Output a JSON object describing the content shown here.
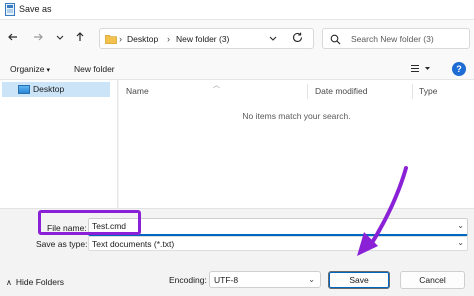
{
  "window": {
    "title": "Save as"
  },
  "address": {
    "crumbs": [
      "Desktop",
      "New folder (3)"
    ]
  },
  "search": {
    "placeholder": "Search New folder (3)"
  },
  "toolbar": {
    "organize": "Organize",
    "new_folder": "New folder"
  },
  "nav": {
    "items": [
      {
        "label": "Desktop",
        "selected": true
      }
    ]
  },
  "files": {
    "columns": [
      "Name",
      "Date modified",
      "Type"
    ],
    "empty_message": "No items match your search."
  },
  "form": {
    "file_name_label": "File name:",
    "file_name_value": "Test.cmd",
    "save_type_label": "Save as type:",
    "save_type_value": "Text documents (*.txt)",
    "encoding_label": "Encoding:",
    "encoding_value": "UTF-8"
  },
  "footer": {
    "hide_folders": "Hide Folders",
    "save": "Save",
    "cancel": "Cancel"
  },
  "colors": {
    "accent": "#0067c0",
    "highlight": "#8a21d6",
    "selected_nav": "#cce4f7"
  },
  "icons": [
    "app-icon",
    "back-arrow-icon",
    "forward-arrow-icon",
    "history-chevron-icon",
    "up-arrow-icon",
    "folder-icon",
    "breadcrumb-chevron-icon",
    "refresh-icon",
    "search-icon",
    "view-icon",
    "help-icon",
    "desktop-icon",
    "dropdown-icon",
    "collapse-chevron-icon",
    "annotation-arrow"
  ]
}
